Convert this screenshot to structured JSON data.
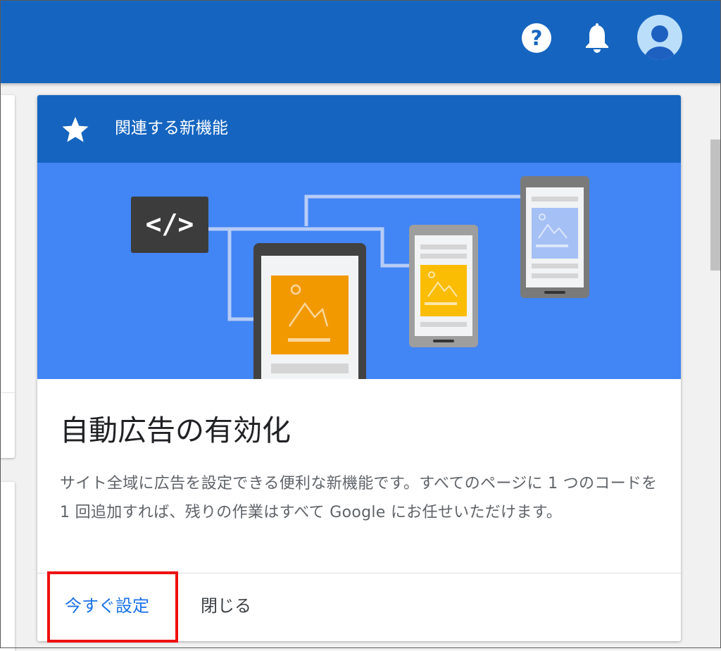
{
  "topbar": {
    "help_icon": "help-circle-icon",
    "help_glyph": "?",
    "bell_icon": "bell-icon",
    "avatar_icon": "account-avatar-icon",
    "color": "#1565c0"
  },
  "card": {
    "header": {
      "icon": "star-icon",
      "title": "関連する新機能",
      "color": "#1565c0"
    },
    "illustration": {
      "code_glyph": "</>",
      "background": "#4285f4",
      "accent_orange": "#f29900",
      "accent_yellow": "#fbbc04"
    },
    "title": "自動広告の有効化",
    "description": "サイト全域に広告を設定できる便利な新機能です。すべてのページに 1 つのコードを 1 回追加すれば、残りの作業はすべて Google にお任せいただけます。",
    "actions": {
      "setup_label": "今すぐ設定",
      "close_label": "閉じる"
    }
  },
  "annotation": {
    "highlight_color": "#ee1111"
  }
}
